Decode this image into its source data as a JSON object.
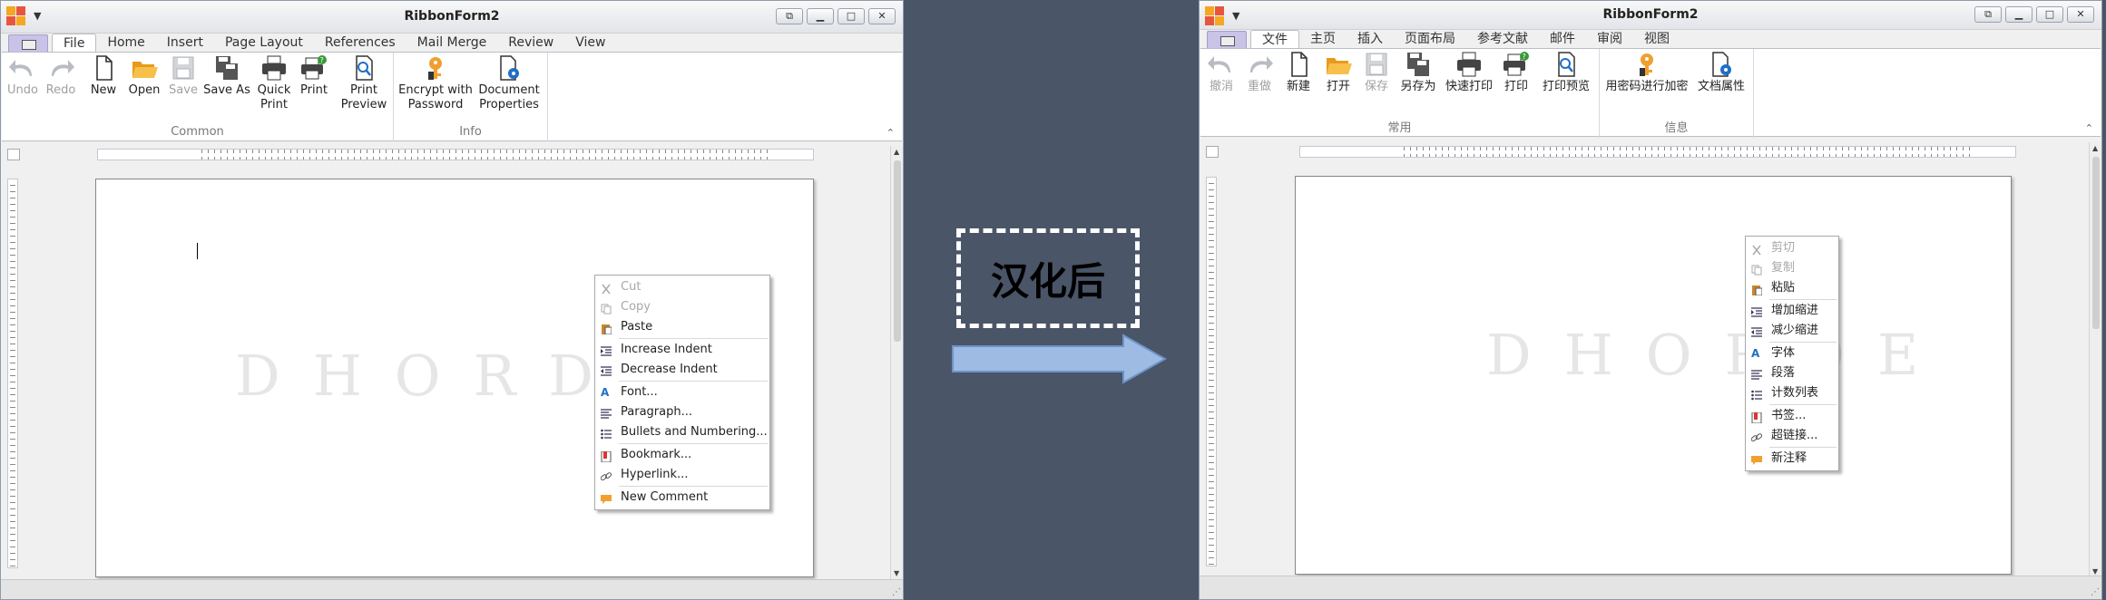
{
  "left": {
    "title": "RibbonForm2",
    "tabs": [
      "File",
      "Home",
      "Insert",
      "Page Layout",
      "References",
      "Mail Merge",
      "Review",
      "View"
    ],
    "active_tab_index": 0,
    "groups": {
      "common_label": "Common",
      "info_label": "Info"
    },
    "buttons": {
      "undo": "Undo",
      "redo": "Redo",
      "new": "New",
      "open": "Open",
      "save": "Save",
      "save_as": "Save As",
      "quick_print_1": "Quick",
      "quick_print_2": "Print",
      "print": "Print",
      "print_preview_1": "Print",
      "print_preview_2": "Preview",
      "encrypt_1": "Encrypt with",
      "encrypt_2": "Password",
      "docprops_1": "Document",
      "docprops_2": "Properties"
    },
    "watermark": "DHORDE",
    "context_menu": {
      "cut": "Cut",
      "copy": "Copy",
      "paste": "Paste",
      "increase_indent": "Increase Indent",
      "decrease_indent": "Decrease Indent",
      "font": "Font...",
      "paragraph": "Paragraph...",
      "bullets": "Bullets and Numbering...",
      "bookmark": "Bookmark...",
      "hyperlink": "Hyperlink...",
      "new_comment": "New Comment"
    }
  },
  "center": {
    "label": "汉化后"
  },
  "right": {
    "title": "RibbonForm2",
    "tabs": [
      "文件",
      "主页",
      "插入",
      "页面布局",
      "参考文献",
      "邮件",
      "审阅",
      "视图"
    ],
    "active_tab_index": 0,
    "groups": {
      "common_label": "常用",
      "info_label": "信息"
    },
    "buttons": {
      "undo": "撤消",
      "redo": "重做",
      "new": "新建",
      "open": "打开",
      "save": "保存",
      "save_as": "另存为",
      "quick_print": "快速打印",
      "print": "打印",
      "print_preview": "打印预览",
      "encrypt": "用密码进行加密",
      "docprops": "文档属性"
    },
    "watermark": "DHORDE",
    "context_menu": {
      "cut": "剪切",
      "copy": "复制",
      "paste": "粘贴",
      "increase_indent": "增加缩进",
      "decrease_indent": "减少缩进",
      "font": "字体",
      "paragraph": "段落",
      "bullets": "计数列表",
      "bookmark": "书签...",
      "hyperlink": "超链接...",
      "new_comment": "新注释"
    }
  },
  "colors": {
    "background": "#4a5568",
    "file_tab": "#c9c3e8",
    "arrow_fill": "#9dbbe3",
    "icon_orange": "#f0a030"
  }
}
